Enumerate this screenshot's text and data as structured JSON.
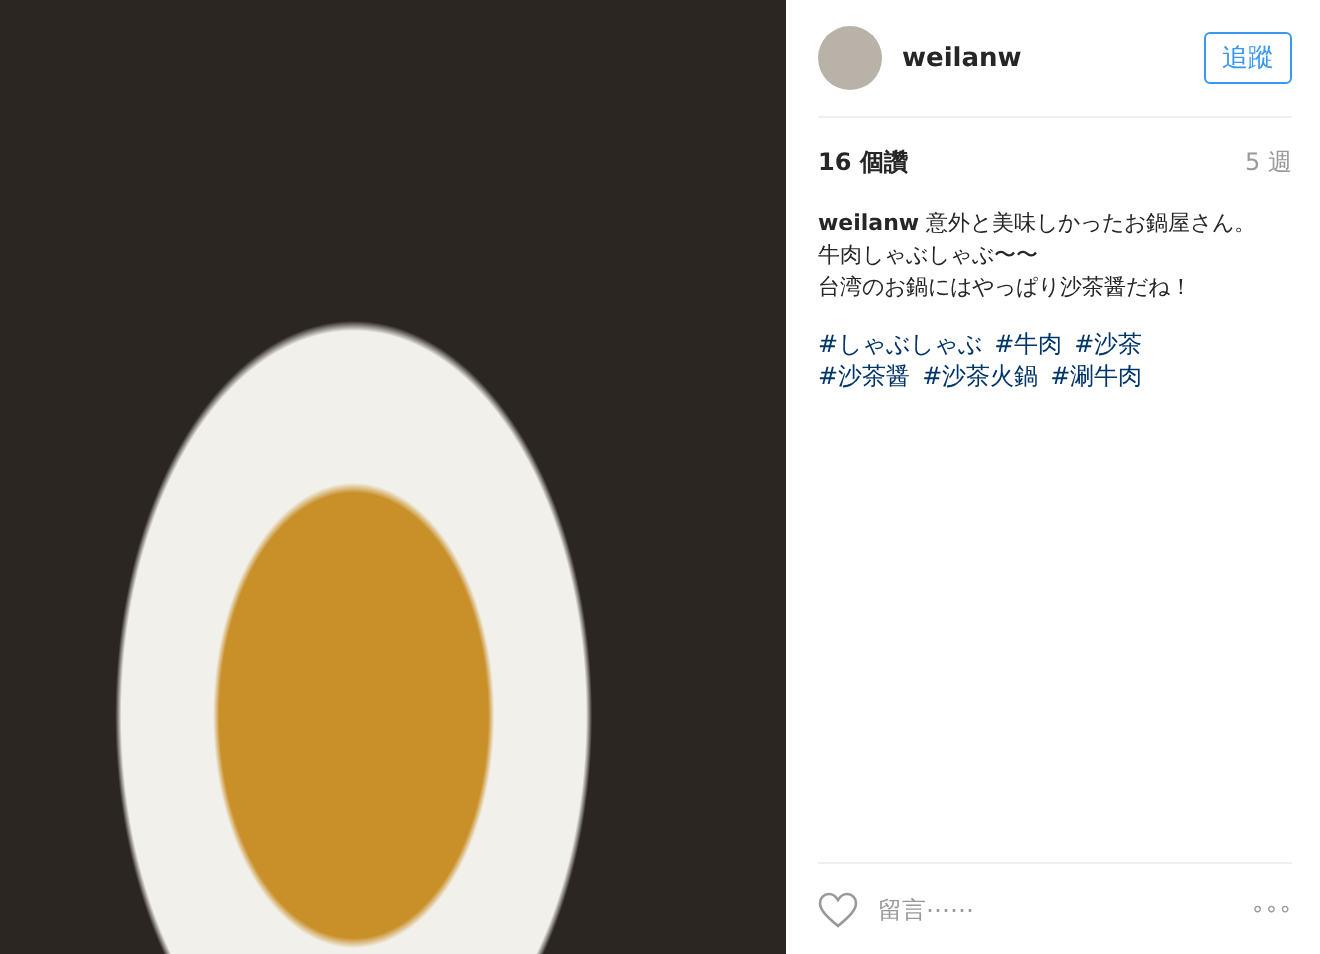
{
  "header": {
    "username": "weilanw",
    "follow_button": "追蹤"
  },
  "likes": "16 個讚",
  "time": "5 週",
  "caption": [
    "**weilanw** 意外と美味しかったお鍋屋さん。",
    "牛肉しゃぶしゃぶ〜〜",
    "台湾のお鍋にはやっぱり沙茶醤だね！"
  ],
  "tags": [
    "#しゃぶしゃぶ",
    "#牛肉",
    "#沙茶",
    "#沙茶醤",
    "#沙茶火鍋",
    "#涮牛肉"
  ],
  "comment": {
    "placeholder": "留言⋯⋯",
    "liked": false,
    "more": "∘∘∘"
  }
}
